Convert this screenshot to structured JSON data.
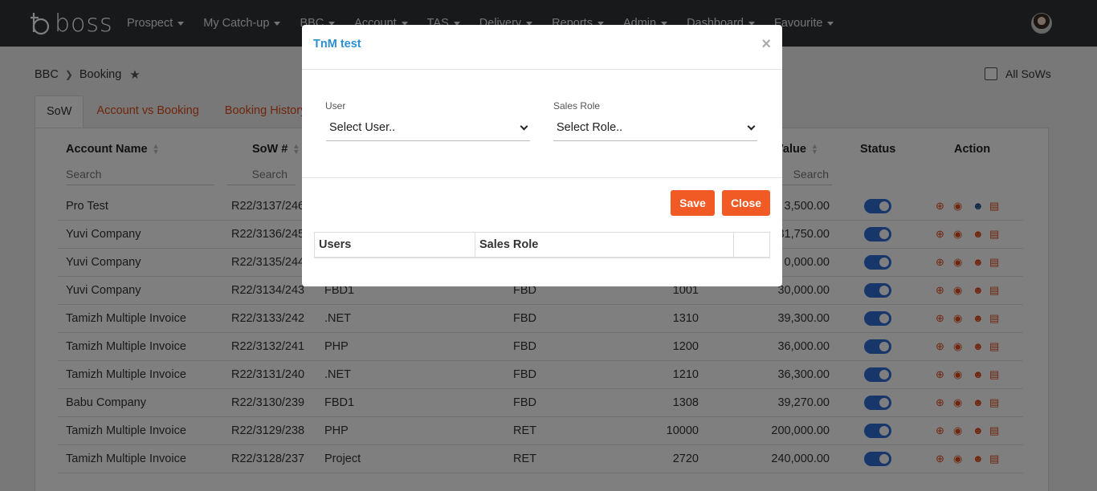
{
  "brand": {
    "logo_text": "boss"
  },
  "nav": [
    "Prospect",
    "My Catch-up",
    "BBC",
    "Account",
    "TAS",
    "Delivery",
    "Reports",
    "Admin",
    "Dashboard",
    "Favourite"
  ],
  "breadcrumb": {
    "root": "BBC",
    "current": "Booking"
  },
  "all_sows_label": "All SoWs",
  "tabs": [
    "SoW",
    "Account vs Booking",
    "Booking History"
  ],
  "table": {
    "headers": {
      "account": "Account Name",
      "sow": "SoW #",
      "value": "l Value",
      "status": "Status",
      "action": "Action"
    },
    "search_placeholder": "Search",
    "rows": [
      {
        "account": "Pro Test",
        "sow": "R22/3137/246",
        "tech": "",
        "type": "",
        "qty": "",
        "value": "3,500.00"
      },
      {
        "account": "Yuvi Company",
        "sow": "R22/3136/245",
        "tech": "",
        "type": "",
        "qty": "",
        "value": "31,750.00"
      },
      {
        "account": "Yuvi Company",
        "sow": "R22/3135/244",
        "tech": "",
        "type": "",
        "qty": "",
        "value": "0,000.00"
      },
      {
        "account": "Yuvi Company",
        "sow": "R22/3134/243",
        "tech": "FBD1",
        "type": "FBD",
        "qty": "1001",
        "value": "30,000.00"
      },
      {
        "account": "Tamizh Multiple Invoice",
        "sow": "R22/3133/242",
        "tech": ".NET",
        "type": "FBD",
        "qty": "1310",
        "value": "39,300.00"
      },
      {
        "account": "Tamizh Multiple Invoice",
        "sow": "R22/3132/241",
        "tech": "PHP",
        "type": "FBD",
        "qty": "1200",
        "value": "36,000.00"
      },
      {
        "account": "Tamizh Multiple Invoice",
        "sow": "R22/3131/240",
        "tech": ".NET",
        "type": "FBD",
        "qty": "1210",
        "value": "36,300.00"
      },
      {
        "account": "Babu Company",
        "sow": "R22/3130/239",
        "tech": "FBD1",
        "type": "FBD",
        "qty": "1308",
        "value": "39,270.00"
      },
      {
        "account": "Tamizh Multiple Invoice",
        "sow": "R22/3129/238",
        "tech": "PHP",
        "type": "RET",
        "qty": "10000",
        "value": "200,000.00"
      },
      {
        "account": "Tamizh Multiple Invoice",
        "sow": "R22/3128/237",
        "tech": "Project",
        "type": "RET",
        "qty": "2720",
        "value": "240,000.00"
      }
    ]
  },
  "modal": {
    "title": "TnM test",
    "user_label": "User",
    "user_value": "Select User..",
    "role_label": "Sales Role",
    "role_value": "Select Role..",
    "save_label": "Save",
    "close_label": "Close",
    "table_headers": [
      "Users",
      "Sales Role",
      ""
    ]
  },
  "colors": {
    "accent": "#f15a24",
    "link": "#2b8fd0",
    "toggle": "#2f6fd6",
    "navbar": "#2e3336"
  }
}
